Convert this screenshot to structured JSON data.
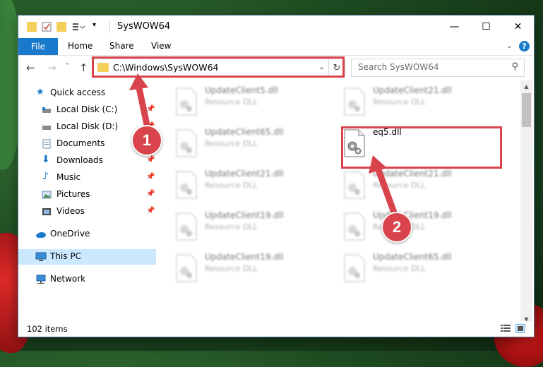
{
  "window": {
    "title": "SysWOW64",
    "controls": {
      "minimize": "—",
      "maximize": "☐",
      "close": "✕"
    }
  },
  "ribbon": {
    "tabs": [
      "File",
      "Home",
      "Share",
      "View"
    ],
    "help": "?"
  },
  "navigation": {
    "back": "←",
    "forward": "→",
    "recent": "˅",
    "up": "↑",
    "address": "C:\\Windows\\SysWOW64",
    "search_placeholder": "Search SysWOW64"
  },
  "sidebar": {
    "items": [
      {
        "label": "Quick access",
        "icon": "star-icon",
        "pinned": false
      },
      {
        "label": "Local Disk (C:)",
        "icon": "drive-icon",
        "pinned": true
      },
      {
        "label": "Local Disk (D:)",
        "icon": "drive-icon",
        "pinned": true
      },
      {
        "label": "Documents",
        "icon": "documents-icon",
        "pinned": true
      },
      {
        "label": "Downloads",
        "icon": "download-icon",
        "pinned": true
      },
      {
        "label": "Music",
        "icon": "music-icon",
        "pinned": true
      },
      {
        "label": "Pictures",
        "icon": "pictures-icon",
        "pinned": true
      },
      {
        "label": "Videos",
        "icon": "videos-icon",
        "pinned": true
      },
      {
        "label": "OneDrive",
        "icon": "cloud-icon",
        "pinned": false
      },
      {
        "label": "This PC",
        "icon": "computer-icon",
        "pinned": false,
        "selected": true
      },
      {
        "label": "Network",
        "icon": "network-icon",
        "pinned": false
      }
    ]
  },
  "files": [
    {
      "name": "UpdateClient5.dll",
      "type": "Resource DLL",
      "blurred": true
    },
    {
      "name": "UpdateClient21.dll",
      "type": "Resource DLL",
      "blurred": true
    },
    {
      "name": "UpdateClient65.dll",
      "type": "Resource DLL",
      "blurred": true
    },
    {
      "name": "eq5.dll",
      "type": "",
      "blurred": false,
      "highlighted": true
    },
    {
      "name": "UpdateClient21.dll",
      "type": "Resource DLL",
      "blurred": true
    },
    {
      "name": "UpdateClient21.dll",
      "type": "Resource DLL",
      "blurred": true
    },
    {
      "name": "UpdateClient19.dll",
      "type": "Resource DLL",
      "blurred": true
    },
    {
      "name": "UpdateClient19.dll",
      "type": "Resource DLL",
      "blurred": true
    },
    {
      "name": "UpdateClient19.dll",
      "type": "Resource DLL",
      "blurred": true
    },
    {
      "name": "UpdateClient65.dll",
      "type": "Resource DLL",
      "blurred": true
    }
  ],
  "status": {
    "item_count": "102 items"
  },
  "annotations": {
    "step1": "1",
    "step2": "2",
    "color": "#d9434b"
  },
  "colors": {
    "accent": "#1979ca",
    "folder": "#f4cf5a",
    "selected": "#cce8ff"
  }
}
